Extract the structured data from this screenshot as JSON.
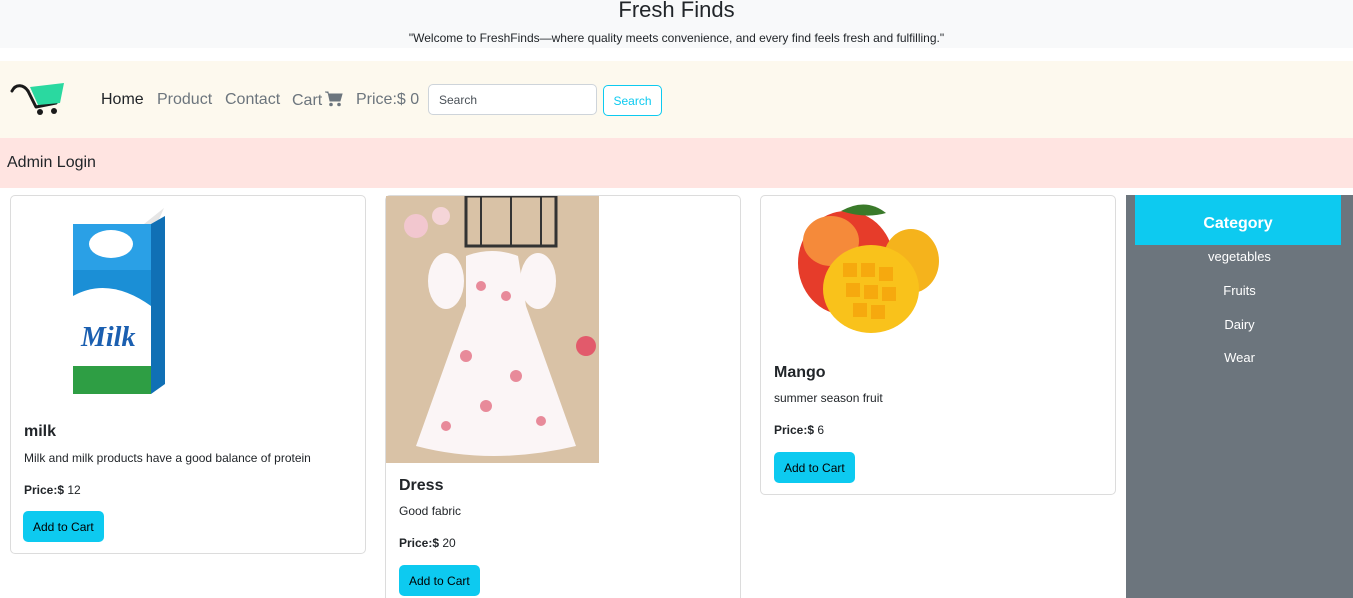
{
  "header": {
    "site_title": "Fresh Finds",
    "tagline": "\"Welcome to FreshFinds—where quality meets convenience, and every find feels fresh and fulfilling.\""
  },
  "nav": {
    "home": "Home",
    "product": "Product",
    "contact": "Contact",
    "cart": "Cart",
    "price": "Price:$ 0",
    "search_placeholder": "Search",
    "search_button": "Search"
  },
  "admin": {
    "label": "Admin Login"
  },
  "products": [
    {
      "name": "milk",
      "description": "Milk and milk products have a good balance of protein",
      "price_label": "Price:$",
      "price": "12",
      "button": "Add to Cart"
    },
    {
      "name": "Dress",
      "description": "Good fabric",
      "price_label": "Price:$",
      "price": "20",
      "button": "Add to Cart"
    },
    {
      "name": "Mango",
      "description": "summer season fruit",
      "price_label": "Price:$",
      "price": "6",
      "button": "Add to Cart"
    }
  ],
  "category": {
    "title": "Category",
    "items": [
      "vegetables",
      "Fruits",
      "Dairy",
      "Wear"
    ]
  },
  "colors": {
    "accent": "#0dcaf0",
    "navbar_bg": "#fdf9ee",
    "admin_bg": "#ffe4e1",
    "sidebar_bg": "#6c757d"
  },
  "icons": {
    "logo": "cart-logo-icon",
    "cart": "shopping-cart-icon"
  }
}
